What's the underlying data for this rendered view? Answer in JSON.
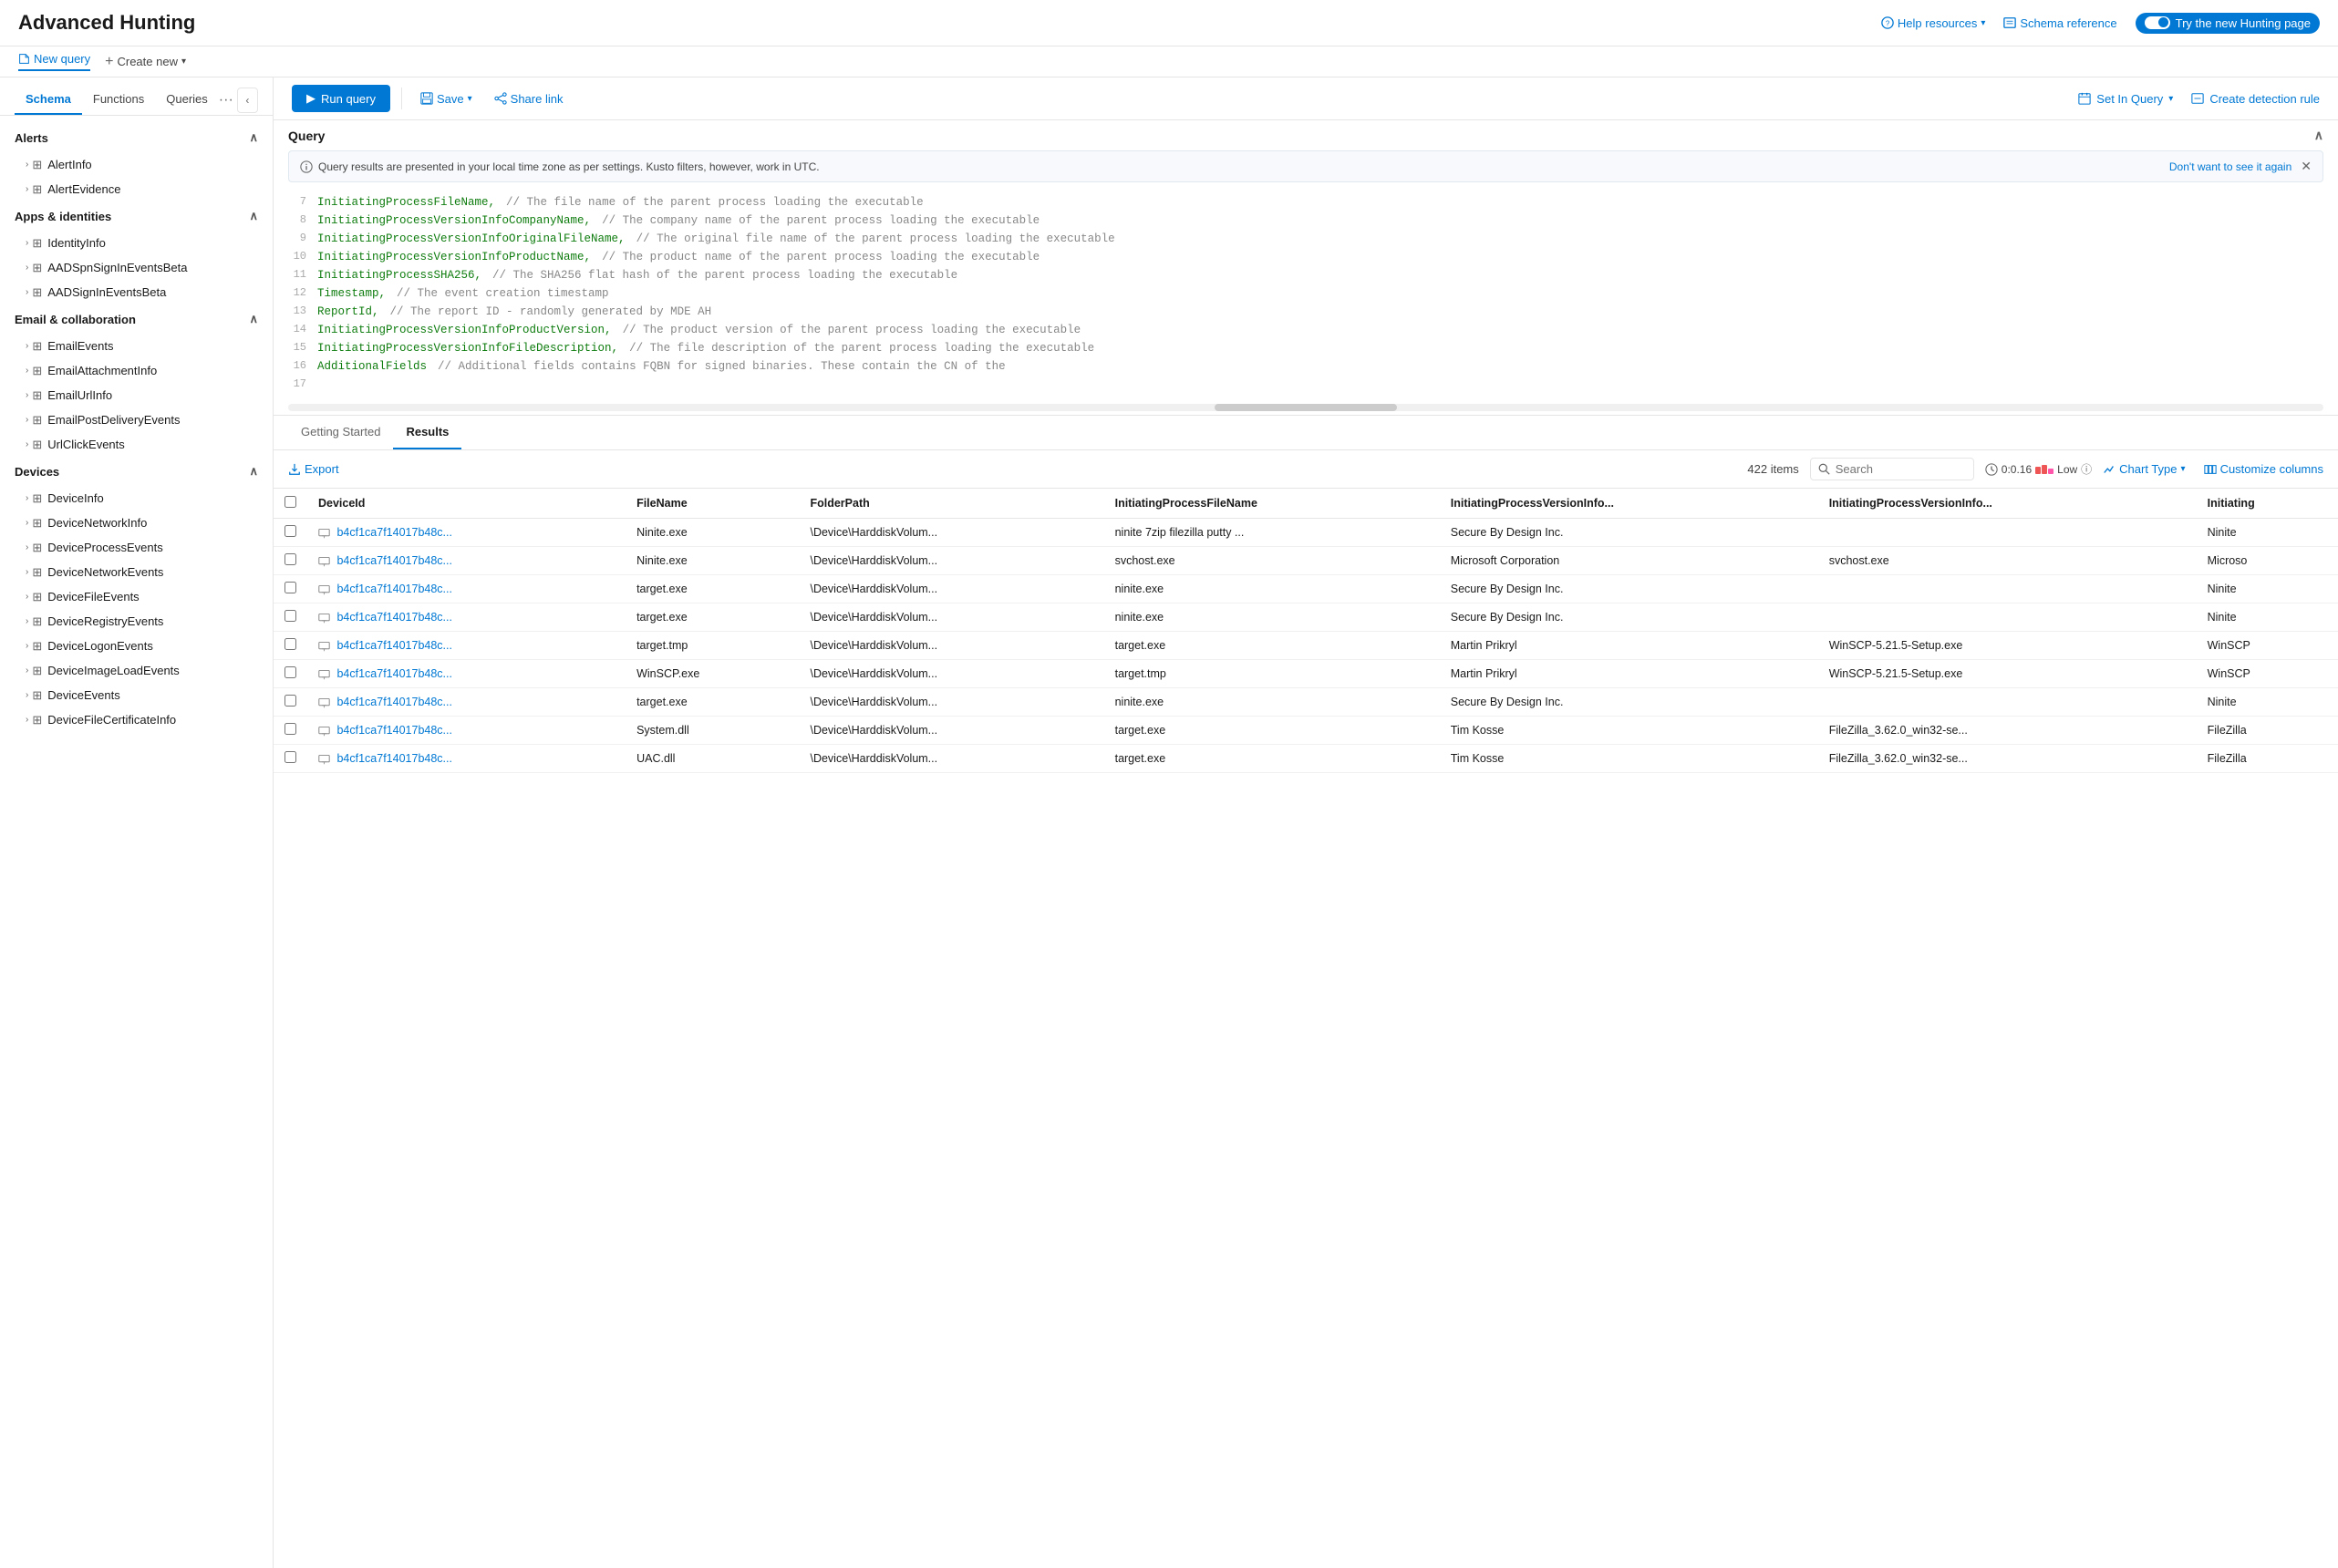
{
  "header": {
    "title": "Advanced Hunting",
    "helpLabel": "Help resources",
    "schemaLabel": "Schema reference",
    "tryNewLabel": "Try the new Hunting page"
  },
  "subtoolbar": {
    "newQuery": "New query",
    "createNew": "Create new"
  },
  "tabs": {
    "schema": "Schema",
    "functions": "Functions",
    "queries": "Queries"
  },
  "toolbar": {
    "runQuery": "Run query",
    "save": "Save",
    "shareLink": "Share link",
    "setInQuery": "Set In Query",
    "createDetection": "Create detection rule"
  },
  "query": {
    "sectionLabel": "Query",
    "infoBanner": "Query results are presented in your local time zone as per settings. Kusto filters, however, work in UTC.",
    "dontShow": "Don't want to see it again",
    "lines": [
      {
        "num": 7,
        "code": "InitiatingProcessFileName,",
        "comment": "// The file name of the parent process loading the executable"
      },
      {
        "num": 8,
        "code": "InitiatingProcessVersionInfoCompanyName,",
        "comment": "// The company name of the parent process loading the executable"
      },
      {
        "num": 9,
        "code": "InitiatingProcessVersionInfoOriginalFileName,",
        "comment": "// The original file name of the parent process loading the executable"
      },
      {
        "num": 10,
        "code": "InitiatingProcessVersionInfoProductName,",
        "comment": "// The product name of the parent process loading the executable"
      },
      {
        "num": 11,
        "code": "InitiatingProcessSHA256,",
        "comment": "// The SHA256 flat hash of the parent process loading the executable"
      },
      {
        "num": 12,
        "code": "Timestamp,",
        "comment": "// The event creation timestamp"
      },
      {
        "num": 13,
        "code": "ReportId,",
        "comment": "// The report ID - randomly generated by MDE AH"
      },
      {
        "num": 14,
        "code": "InitiatingProcessVersionInfoProductVersion,",
        "comment": "// The product version of the parent process loading the executable"
      },
      {
        "num": 15,
        "code": "InitiatingProcessVersionInfoFileDescription,",
        "comment": "// The file description of the parent process loading the executable"
      },
      {
        "num": 16,
        "code": "AdditionalFields",
        "comment": "// Additional fields contains FQBN for signed binaries.  These contain the CN of the"
      },
      {
        "num": 17,
        "code": "",
        "comment": ""
      }
    ]
  },
  "results": {
    "gettingStarted": "Getting Started",
    "results": "Results",
    "exportLabel": "Export",
    "itemCount": "422 items",
    "searchPlaceholder": "Search",
    "timeLabel": "0:0.16",
    "lowLabel": "Low",
    "chartType": "Chart Type",
    "customizeColumns": "Customize columns",
    "columns": [
      "DeviceId",
      "FileName",
      "FolderPath",
      "InitiatingProcessFileName",
      "InitiatingProcessVersionInfo...",
      "InitiatingProcessVersionInfo...",
      "Initiating"
    ],
    "rows": [
      {
        "deviceId": "b4cf1ca7f14017b48c...",
        "fileName": "Ninite.exe",
        "folderPath": "\\Device\\HarddiskVolum...",
        "initFileName": "ninite 7zip filezilla putty ...",
        "versionInfo1": "Secure By Design Inc.",
        "versionInfo2": "",
        "initiating": "Ninite"
      },
      {
        "deviceId": "b4cf1ca7f14017b48c...",
        "fileName": "Ninite.exe",
        "folderPath": "\\Device\\HarddiskVolum...",
        "initFileName": "svchost.exe",
        "versionInfo1": "Microsoft Corporation",
        "versionInfo2": "svchost.exe",
        "initiating": "Microso"
      },
      {
        "deviceId": "b4cf1ca7f14017b48c...",
        "fileName": "target.exe",
        "folderPath": "\\Device\\HarddiskVolum...",
        "initFileName": "ninite.exe",
        "versionInfo1": "Secure By Design Inc.",
        "versionInfo2": "",
        "initiating": "Ninite"
      },
      {
        "deviceId": "b4cf1ca7f14017b48c...",
        "fileName": "target.exe",
        "folderPath": "\\Device\\HarddiskVolum...",
        "initFileName": "ninite.exe",
        "versionInfo1": "Secure By Design Inc.",
        "versionInfo2": "",
        "initiating": "Ninite"
      },
      {
        "deviceId": "b4cf1ca7f14017b48c...",
        "fileName": "target.tmp",
        "folderPath": "\\Device\\HarddiskVolum...",
        "initFileName": "target.exe",
        "versionInfo1": "Martin Prikryl",
        "versionInfo2": "WinSCP-5.21.5-Setup.exe",
        "initiating": "WinSCP"
      },
      {
        "deviceId": "b4cf1ca7f14017b48c...",
        "fileName": "WinSCP.exe",
        "folderPath": "\\Device\\HarddiskVolum...",
        "initFileName": "target.tmp",
        "versionInfo1": "Martin Prikryl",
        "versionInfo2": "WinSCP-5.21.5-Setup.exe",
        "initiating": "WinSCP"
      },
      {
        "deviceId": "b4cf1ca7f14017b48c...",
        "fileName": "target.exe",
        "folderPath": "\\Device\\HarddiskVolum...",
        "initFileName": "ninite.exe",
        "versionInfo1": "Secure By Design Inc.",
        "versionInfo2": "",
        "initiating": "Ninite"
      },
      {
        "deviceId": "b4cf1ca7f14017b48c...",
        "fileName": "System.dll",
        "folderPath": "\\Device\\HarddiskVolum...",
        "initFileName": "target.exe",
        "versionInfo1": "Tim Kosse",
        "versionInfo2": "FileZilla_3.62.0_win32-se...",
        "initiating": "FileZilla"
      },
      {
        "deviceId": "b4cf1ca7f14017b48c...",
        "fileName": "UAC.dll",
        "folderPath": "\\Device\\HarddiskVolum...",
        "initFileName": "target.exe",
        "versionInfo1": "Tim Kosse",
        "versionInfo2": "FileZilla_3.62.0_win32-se...",
        "initiating": "FileZilla"
      }
    ]
  },
  "sidebar": {
    "sections": [
      {
        "name": "Alerts",
        "expanded": true,
        "items": [
          {
            "name": "AlertInfo"
          },
          {
            "name": "AlertEvidence"
          }
        ]
      },
      {
        "name": "Apps & identities",
        "expanded": true,
        "items": [
          {
            "name": "IdentityInfo"
          },
          {
            "name": "AADSpnSignInEventsBeta"
          },
          {
            "name": "AADSignInEventsBeta"
          }
        ]
      },
      {
        "name": "Email & collaboration",
        "expanded": true,
        "items": [
          {
            "name": "EmailEvents"
          },
          {
            "name": "EmailAttachmentInfo"
          },
          {
            "name": "EmailUrlInfo"
          },
          {
            "name": "EmailPostDeliveryEvents"
          },
          {
            "name": "UrlClickEvents"
          }
        ]
      },
      {
        "name": "Devices",
        "expanded": true,
        "items": [
          {
            "name": "DeviceInfo"
          },
          {
            "name": "DeviceNetworkInfo"
          },
          {
            "name": "DeviceProcessEvents"
          },
          {
            "name": "DeviceNetworkEvents"
          },
          {
            "name": "DeviceFileEvents"
          },
          {
            "name": "DeviceRegistryEvents"
          },
          {
            "name": "DeviceLogonEvents"
          },
          {
            "name": "DeviceImageLoadEvents"
          },
          {
            "name": "DeviceEvents"
          },
          {
            "name": "DeviceFileCertificateInfo"
          }
        ]
      }
    ]
  }
}
